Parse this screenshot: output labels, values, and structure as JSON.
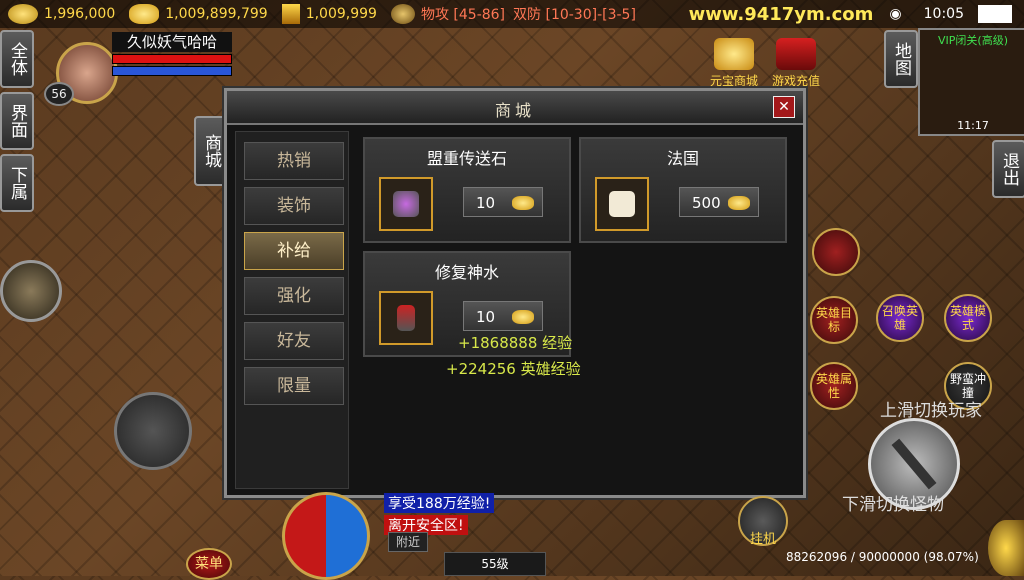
{
  "topbar": {
    "gold": "1,996,000",
    "ingot": "1,009,899,799",
    "bound": "1,009,999",
    "attack": "物攻 [45-86]",
    "defense": "双防 [10-30]-[3-5]",
    "url": "www.9417ym.com",
    "time": "10:05"
  },
  "side": {
    "all": "全体",
    "ui": "界面",
    "sub": "下属",
    "mall": "商城",
    "map": "地图",
    "exit": "退出"
  },
  "player": {
    "name": "久似妖气哈哈",
    "level": "56"
  },
  "top_icons": {
    "yuanbao_shop": "元宝商城",
    "recharge": "游戏充值"
  },
  "minimap": {
    "title": "VIP闭关(高级)",
    "time": "11:17"
  },
  "shop": {
    "title": "商城",
    "close": "✕",
    "tabs": [
      "热销",
      "装饰",
      "补给",
      "强化",
      "好友",
      "限量"
    ],
    "active_tab": "补给",
    "items": [
      {
        "name": "盟重传送石",
        "price": "10"
      },
      {
        "name": "法国",
        "price": "500"
      },
      {
        "name": "修复神水",
        "price": "10"
      }
    ]
  },
  "messages": {
    "exp": "+1868888 经验",
    "hero_exp": "+224256 英雄经验"
  },
  "skills": {
    "hero_target": "英雄目标",
    "summon_hero": "召唤英雄",
    "hero_mode": "英雄模式",
    "hero_attr": "英雄属性",
    "charge": "野蛮冲撞"
  },
  "hints": {
    "swipe_up": "上滑切换玩家",
    "swipe_down": "下滑切换怪物"
  },
  "chat": {
    "line1": "享受188万经验!",
    "line2": "离开安全区!",
    "nearby": "附近"
  },
  "bottom": {
    "menu": "菜单",
    "hang": "挂机",
    "level": "55级",
    "exp": "88262096 / 90000000 (98.07%)"
  },
  "colors": {
    "gold": "#ffd84a",
    "hp": "#d11111",
    "mp": "#2a56d8",
    "active_tab": "#c9a44a"
  }
}
